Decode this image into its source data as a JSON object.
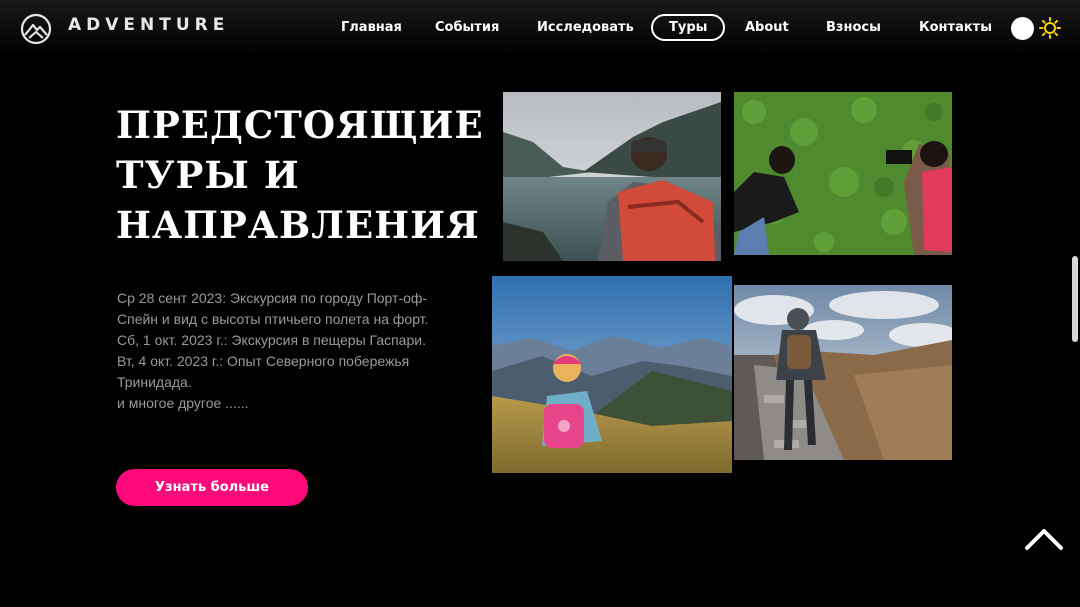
{
  "header": {
    "brand": "ADVENTURE",
    "nav": [
      {
        "label": "Главная"
      },
      {
        "label": "События"
      },
      {
        "label": "Исследовать"
      },
      {
        "label": "Туры",
        "active": true
      },
      {
        "label": "About"
      },
      {
        "label": "Взносы"
      },
      {
        "label": "Контакты"
      }
    ],
    "theme_toggle_icon": "sun-icon"
  },
  "main": {
    "heading_lines": [
      "ПРЕДСТОЯЩИЕ",
      "ТУРЫ И",
      "НАПРАВЛЕНИЯ"
    ],
    "tours": [
      "Ср 28 сент 2023: Экскурсия по городу Порт-оф-Спейн и вид с высоты птичьего полета на форт.",
      "Сб, 1 окт. 2023 г.: Экскурсия в пещеры Гаспари.",
      "Вт, 4 окт. 2023 г.: Опыт Северного побережья Тринидада.",
      "и многое другое ......"
    ],
    "cta_label": "Узнать больше"
  },
  "colors": {
    "accent": "#ff0a7a",
    "background": "#000000",
    "text_muted": "#9a9a9a"
  },
  "icons": {
    "logo": "mountain-logo-icon",
    "scroll_top": "chevron-up-icon"
  }
}
